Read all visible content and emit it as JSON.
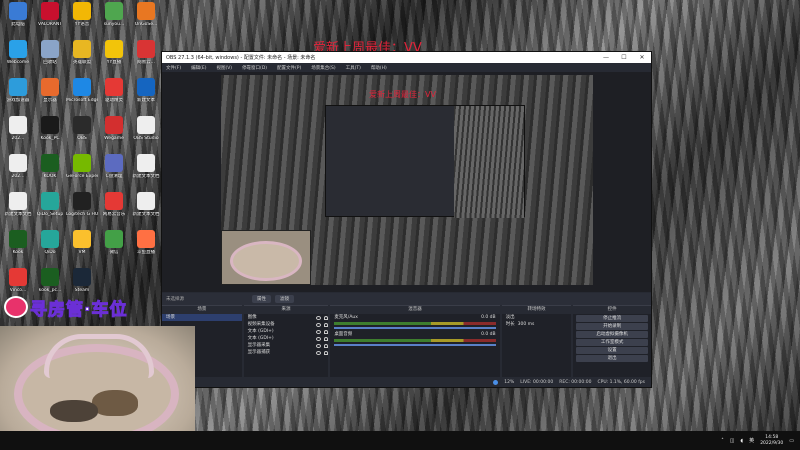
{
  "overlay": {
    "title": "爱新上周最佳：VV",
    "nested_title": "爱新上周最佳：VV",
    "banner": "寻房管·车位"
  },
  "desktop": {
    "icons": [
      {
        "label": "此电脑",
        "color": "#3a7bd5"
      },
      {
        "label": "VALORANT",
        "color": "#c8102e"
      },
      {
        "label": "YY语音",
        "color": "#f2b705"
      },
      {
        "label": "sunyou...",
        "color": "#4fa64f"
      },
      {
        "label": "OnGoSe...",
        "color": "#e87722"
      },
      {
        "label": "Webcome",
        "color": "#2aa1e8"
      },
      {
        "label": "回收站",
        "color": "#8aa4c8"
      },
      {
        "label": "英雄联盟",
        "color": "#e8b722"
      },
      {
        "label": "YY直播",
        "color": "#f2c40a"
      },
      {
        "label": "网易云...",
        "color": "#d93434"
      },
      {
        "label": "游戏加速器",
        "color": "#2d9cdb"
      },
      {
        "label": "显示器",
        "color": "#e86a2d"
      },
      {
        "label": "Microsoft Edge",
        "color": "#1e88e5"
      },
      {
        "label": "驱动精灵",
        "color": "#e53935"
      },
      {
        "label": "新建文本",
        "color": "#1565c0"
      },
      {
        "label": "202...",
        "color": "#eeeeee"
      },
      {
        "label": "Kook_PC",
        "color": "#1a1a1a"
      },
      {
        "label": "OBS",
        "color": "#2b2b2b"
      },
      {
        "label": "Wegame",
        "color": "#d32f2f"
      },
      {
        "label": "OBS Studio",
        "color": "#eeeeee"
      },
      {
        "label": "202...",
        "color": "#eeeeee"
      },
      {
        "label": "KOOK",
        "color": "#1b5e20"
      },
      {
        "label": "GeForce Experience",
        "color": "#76b900"
      },
      {
        "label": "C盘清理",
        "color": "#5c6bc0"
      },
      {
        "label": "新建文本文档",
        "color": "#eeeeee"
      },
      {
        "label": "新建文本文档",
        "color": "#eeeeee"
      },
      {
        "label": "QiDo_Setup",
        "color": "#26a69a"
      },
      {
        "label": "Logitech G HUB",
        "color": "#212121"
      },
      {
        "label": "网易云音乐",
        "color": "#e53935"
      },
      {
        "label": "新建文本文档",
        "color": "#eeeeee"
      },
      {
        "label": "Kook",
        "color": "#1b5e20"
      },
      {
        "label": "QiDo",
        "color": "#26a69a"
      },
      {
        "label": "VM",
        "color": "#fbc02d"
      },
      {
        "label": "微信",
        "color": "#43a047"
      },
      {
        "label": "斗鱼直播",
        "color": "#ff7043"
      },
      {
        "label": "Vinco...",
        "color": "#e53935"
      },
      {
        "label": "kook_pc...",
        "color": "#1b5e20"
      },
      {
        "label": "Steam",
        "color": "#1b2838"
      }
    ]
  },
  "obs": {
    "title": "OBS 27.1.3 (64-bit, windows) - 配置文件: 未命名 - 场景: 未命名",
    "menu": [
      "文件(F)",
      "编辑(E)",
      "视图(V)",
      "停靠窗口(D)",
      "配置文件(P)",
      "场景集合(S)",
      "工具(T)",
      "帮助(H)"
    ],
    "source_bar": {
      "label": "未选择源",
      "props": "属性",
      "filters": "滤镜"
    },
    "docks": {
      "scenes": {
        "header": "场景",
        "items": [
          "场景"
        ]
      },
      "sources": {
        "header": "来源",
        "items": [
          "图像",
          "视频采集设备",
          "文本 (GDI+)",
          "文本 (GDI+)",
          "显示器采集",
          "显示器捕获"
        ]
      },
      "mixer": {
        "header": "混音器",
        "channels": [
          {
            "name": "麦克风/Aux",
            "db": "0.0 dB"
          },
          {
            "name": "桌面音频",
            "db": "0.0 dB"
          }
        ]
      },
      "transitions": {
        "header": "转场特效",
        "type": "淡出",
        "duration_label": "时长",
        "duration": "300 ms"
      },
      "controls": {
        "header": "控件",
        "buttons": [
          "停止推流",
          "开始录制",
          "启动虚拟摄像机",
          "工作室模式",
          "设置",
          "退出"
        ]
      }
    },
    "status": {
      "live": "LIVE: 00:00:00",
      "rec": "REC: 00:00:00",
      "cpu": "CPU: 1.1%, 60.00 fps",
      "dropped": "12%"
    }
  },
  "taskbar": {
    "time": "14:58",
    "date": "2022/9/30"
  }
}
